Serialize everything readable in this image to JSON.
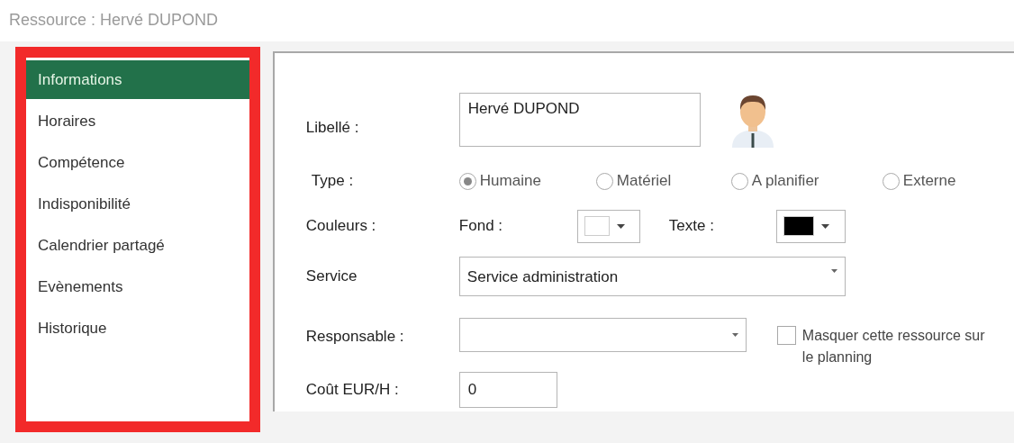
{
  "window": {
    "title": "Ressource : Hervé DUPOND"
  },
  "sidebar": {
    "items": [
      {
        "label": "Informations",
        "selected": true
      },
      {
        "label": "Horaires",
        "selected": false
      },
      {
        "label": "Compétence",
        "selected": false
      },
      {
        "label": "Indisponibilité",
        "selected": false
      },
      {
        "label": "Calendrier partagé",
        "selected": false
      },
      {
        "label": "Evènements",
        "selected": false
      },
      {
        "label": "Historique",
        "selected": false
      }
    ]
  },
  "form": {
    "libelle": {
      "label": "Libellé :",
      "value": "Hervé DUPOND"
    },
    "type": {
      "label": "Type :",
      "options": [
        {
          "label": "Humaine",
          "selected": true
        },
        {
          "label": "Matériel",
          "selected": false
        },
        {
          "label": "A planifier",
          "selected": false
        },
        {
          "label": "Externe",
          "selected": false
        }
      ]
    },
    "couleurs": {
      "label": "Couleurs :",
      "fond": {
        "label": "Fond :",
        "color": "#ffffff"
      },
      "texte": {
        "label": "Texte :",
        "color": "#000000"
      }
    },
    "service": {
      "label": "Service",
      "value": "Service administration"
    },
    "responsable": {
      "label": "Responsable :"
    },
    "masquer": {
      "label": "Masquer cette ressource sur le planning",
      "checked": false
    },
    "cout": {
      "label": "Coût EUR/H :",
      "value": "0"
    }
  }
}
